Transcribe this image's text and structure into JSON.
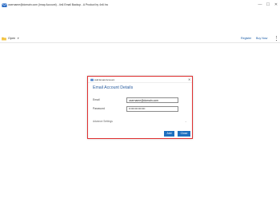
{
  "window": {
    "title": "username@domain.com (Imap Account) - 4n6 Email Backup - A Product by 4n6 Inc",
    "minimize": "—",
    "maximize": "☐",
    "close": "✕"
  },
  "toolbar": {
    "open_label": "Open",
    "register_label": "Register",
    "buynow_label": "Buy Now"
  },
  "dialog": {
    "title": "Add Email Account",
    "close": "✕",
    "heading": "Email Account Details",
    "email_label": "Email",
    "email_value": "username@domain.com",
    "password_label": "Password",
    "password_value": "••••••••••••••••",
    "advanced_label": "Advance Settings",
    "advanced_chevron": "⌄",
    "add_label": "Add",
    "close_label": "Close"
  },
  "colors": {
    "accent": "#1e6fbf",
    "heading": "#2a5d9f",
    "dialog_border": "#e03030",
    "link": "#1a5ca6"
  },
  "icons": {
    "app": "envelope-icon",
    "open": "folder-icon",
    "dialog": "envelope-icon",
    "menu": "kebab-menu-icon"
  }
}
